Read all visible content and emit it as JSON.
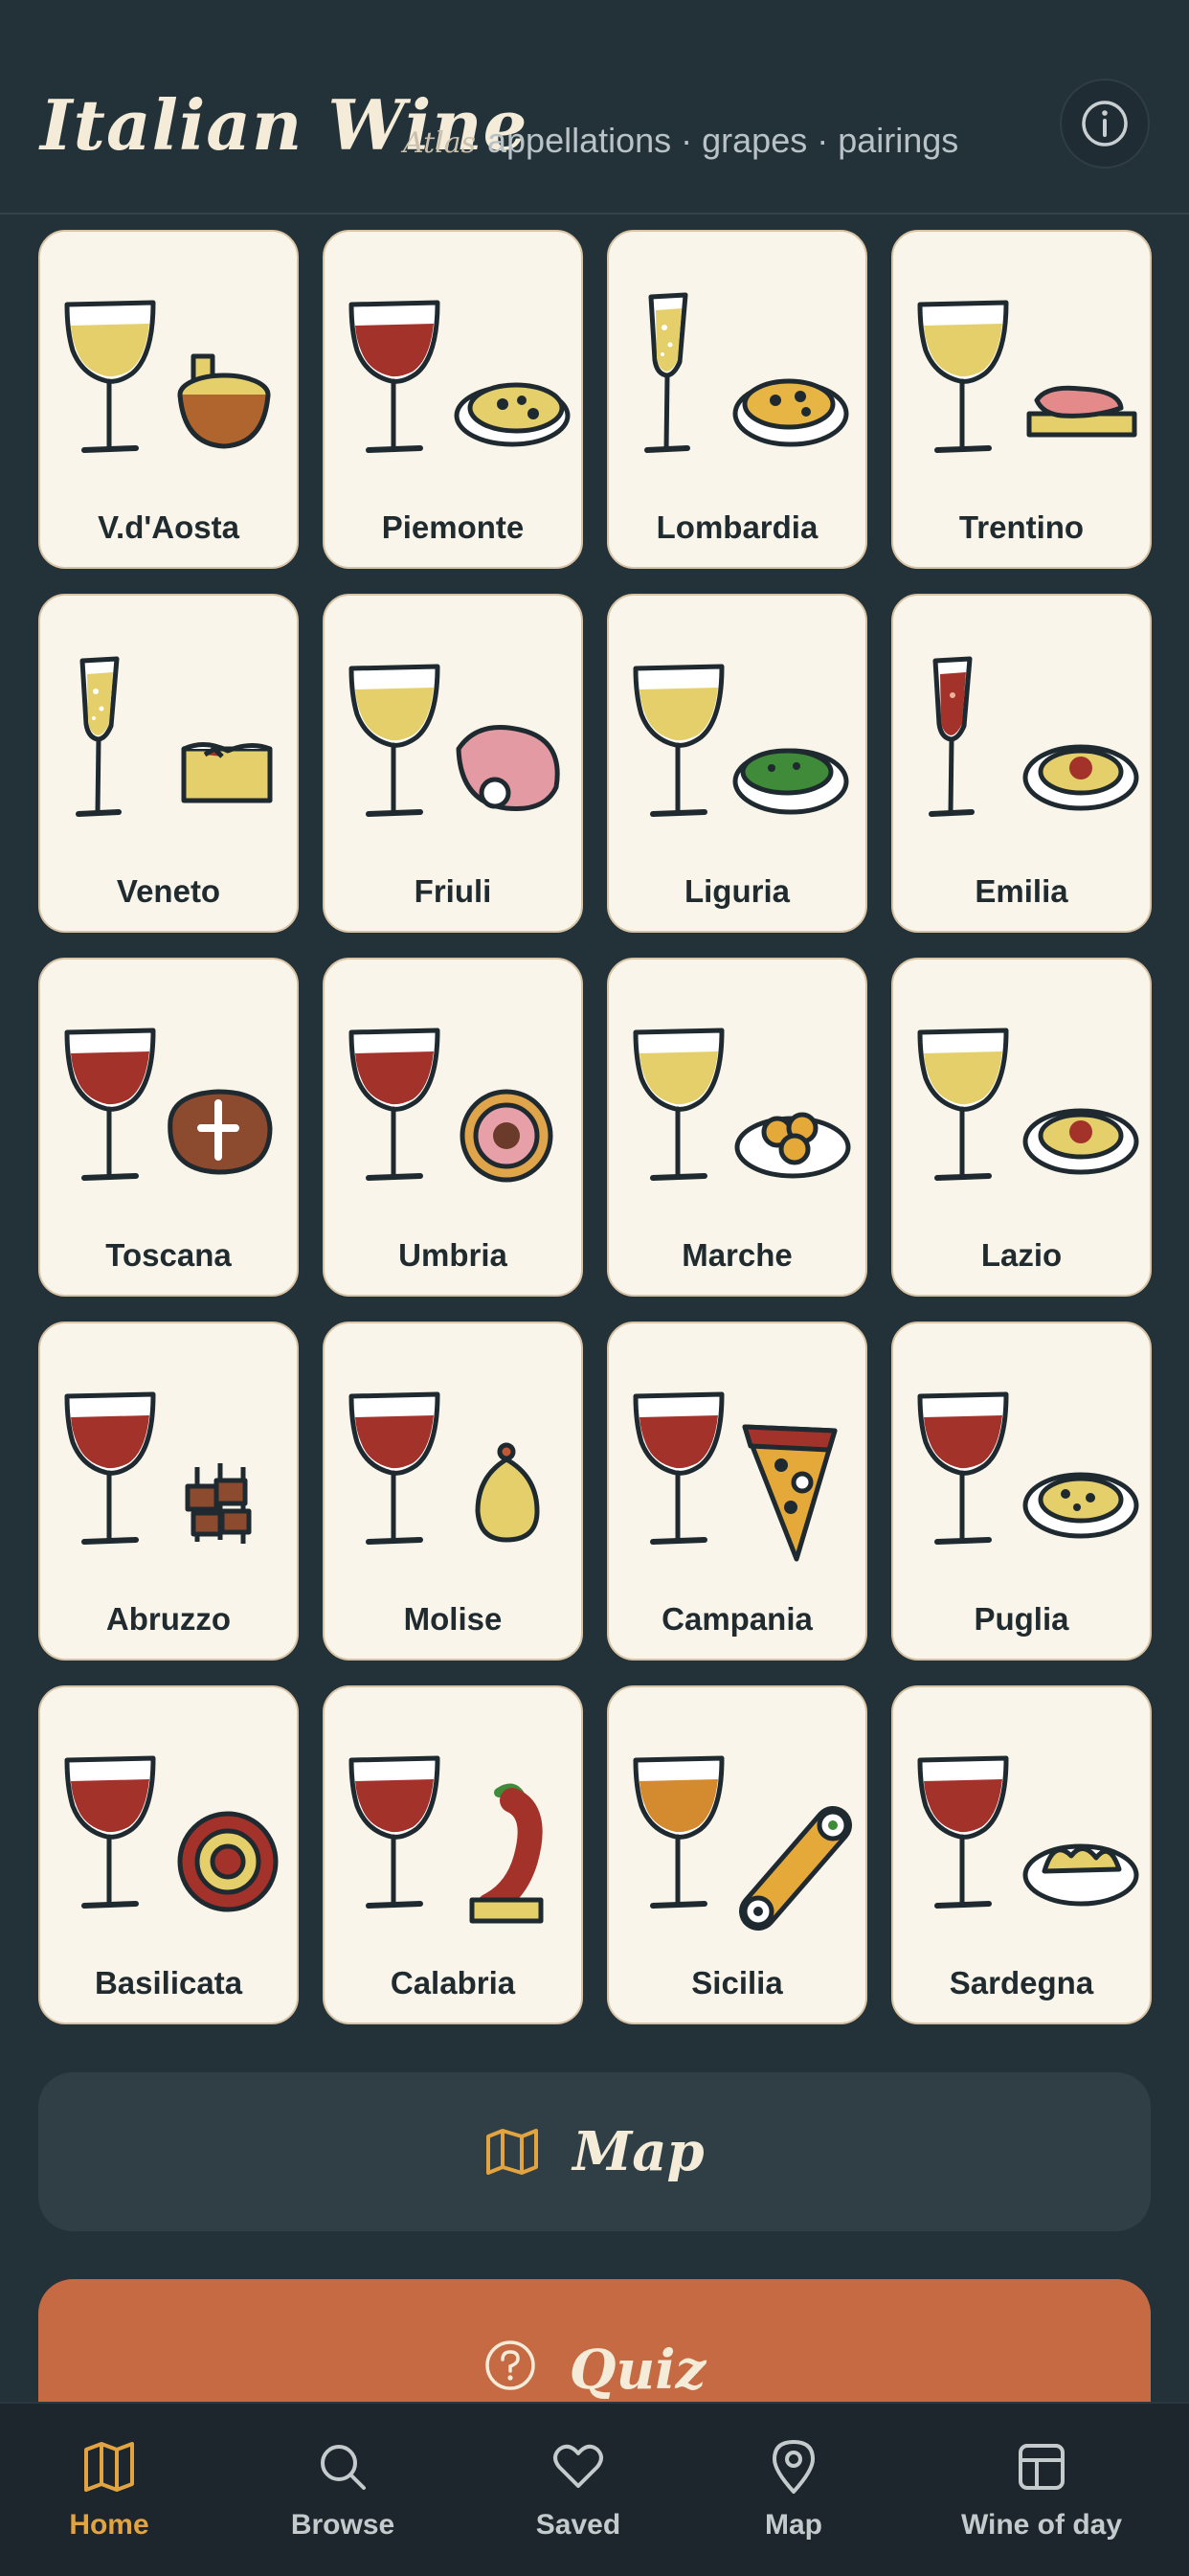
{
  "header": {
    "title": "Italian Wine",
    "atlas": "Atlas",
    "subtitle": "appellations · grapes · pairings",
    "info_icon": "info-circle-icon"
  },
  "regions": [
    {
      "name": "V.d'Aosta",
      "glass": "white",
      "food": "fondue-pot"
    },
    {
      "name": "Piemonte",
      "glass": "red",
      "food": "truffle-plate"
    },
    {
      "name": "Lombardia",
      "glass": "sparkling",
      "food": "risotto-plate"
    },
    {
      "name": "Trentino",
      "glass": "white",
      "food": "speck-board"
    },
    {
      "name": "Veneto",
      "glass": "sparkling",
      "food": "tiramisu"
    },
    {
      "name": "Friuli",
      "glass": "white",
      "food": "prosciutto"
    },
    {
      "name": "Liguria",
      "glass": "white",
      "food": "pesto-plate"
    },
    {
      "name": "Emilia",
      "glass": "red-sparkling",
      "food": "pasta-plate"
    },
    {
      "name": "Toscana",
      "glass": "red",
      "food": "steak"
    },
    {
      "name": "Umbria",
      "glass": "red",
      "food": "truffle-round"
    },
    {
      "name": "Marche",
      "glass": "white",
      "food": "olives-plate"
    },
    {
      "name": "Lazio",
      "glass": "white",
      "food": "pasta-plate"
    },
    {
      "name": "Abruzzo",
      "glass": "red",
      "food": "skewers"
    },
    {
      "name": "Molise",
      "glass": "red",
      "food": "cheese"
    },
    {
      "name": "Campania",
      "glass": "red",
      "food": "pizza-slice"
    },
    {
      "name": "Puglia",
      "glass": "red",
      "food": "orecchiette-plate"
    },
    {
      "name": "Basilicata",
      "glass": "red",
      "food": "sausage-coil"
    },
    {
      "name": "Calabria",
      "glass": "red",
      "food": "chili"
    },
    {
      "name": "Sicilia",
      "glass": "amber",
      "food": "cannolo"
    },
    {
      "name": "Sardegna",
      "glass": "red",
      "food": "culurgiones-plate"
    }
  ],
  "actions": {
    "map_label": "Map",
    "map_icon": "map-icon",
    "quiz_label": "Quiz",
    "quiz_icon": "question-circle-icon"
  },
  "tabs": [
    {
      "label": "Home",
      "icon": "map-icon",
      "active": true
    },
    {
      "label": "Browse",
      "icon": "search-icon",
      "active": false
    },
    {
      "label": "Saved",
      "icon": "heart-icon",
      "active": false
    },
    {
      "label": "Map",
      "icon": "location-pin-icon",
      "active": false
    },
    {
      "label": "Wine of day",
      "icon": "layout-icon",
      "active": false
    }
  ],
  "colors": {
    "background": "#233139",
    "card": "#faf5ea",
    "accent": "#e2a440",
    "quiz": "#c56a43",
    "red_wine": "#a3322a",
    "white_wine": "#e5cf6a",
    "amber_wine": "#d48a2e",
    "ink": "#1e2a30"
  }
}
